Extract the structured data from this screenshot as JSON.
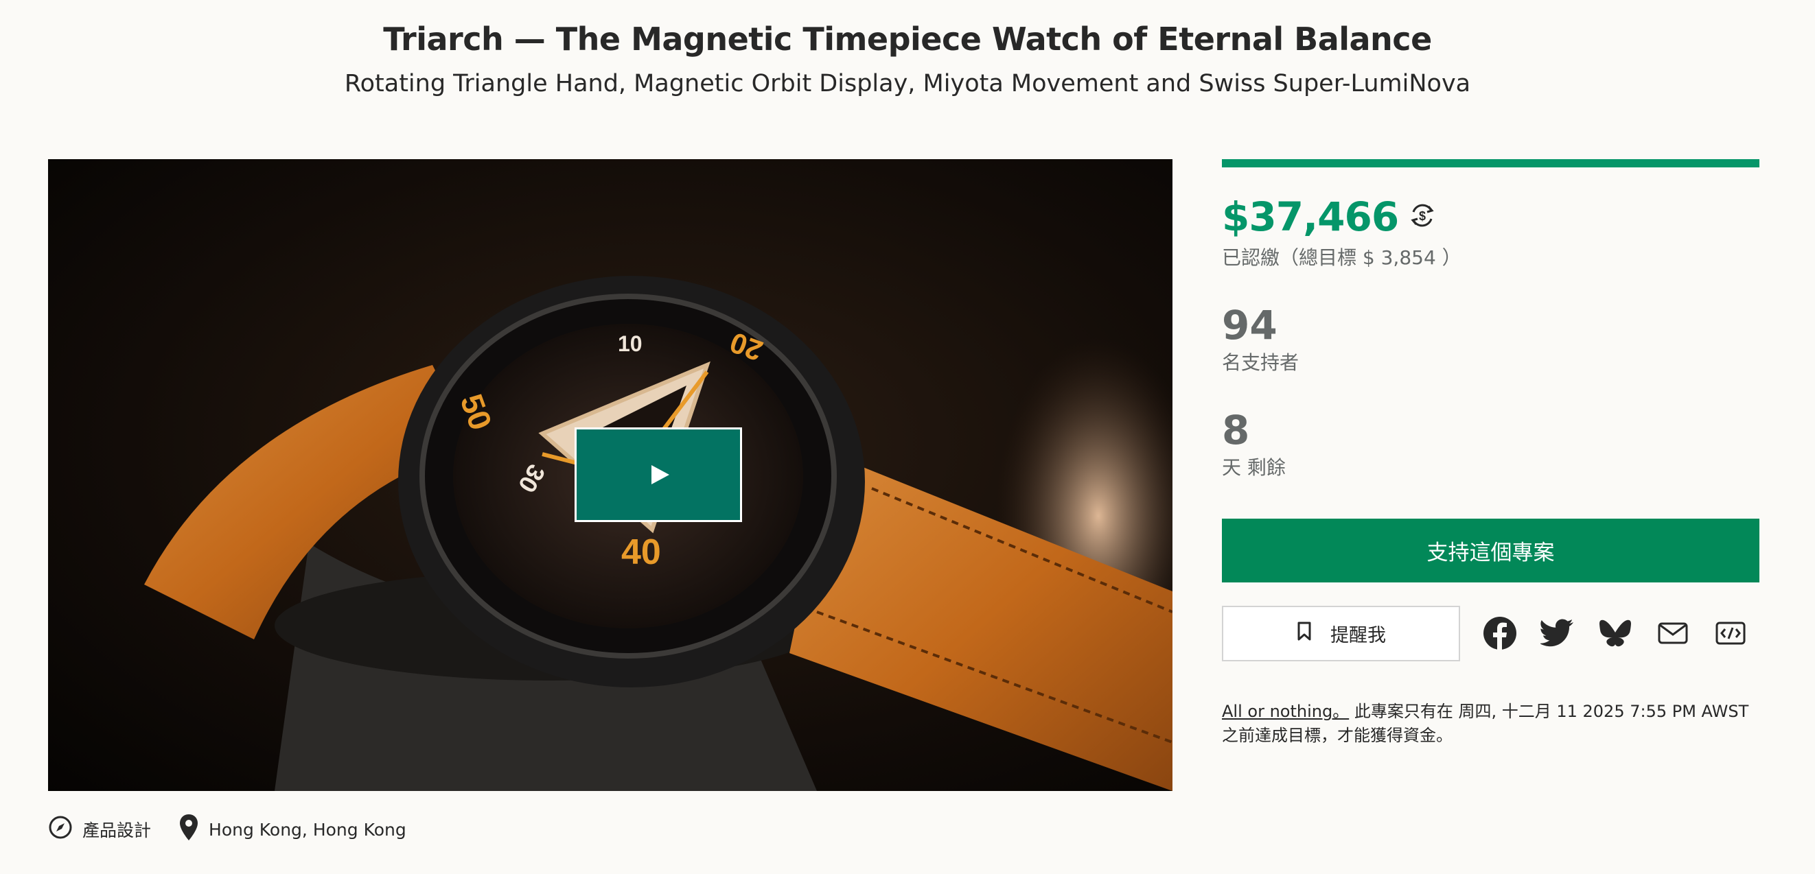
{
  "project": {
    "title": "Triarch — The Magnetic Timepiece Watch of Eternal Balance",
    "subtitle": "Rotating Triangle Hand, Magnetic Orbit Display, Miyota Movement and Swiss Super-LumiNova"
  },
  "media": {
    "play_icon": "play-icon",
    "dial_numbers": [
      "10",
      "20",
      "30",
      "40",
      "50"
    ]
  },
  "meta": {
    "category": "產品設計",
    "category_icon": "compass-icon",
    "location": "Hong Kong, Hong Kong",
    "location_icon": "map-pin-icon"
  },
  "stats": {
    "progress_fraction": 1.0,
    "pledged": "$37,466",
    "currency_icon": "currency-convert-icon",
    "goal": "已認繳（總目標 $ 3,854 ）",
    "backers": "94",
    "backers_label": "名支持者",
    "days": "8",
    "days_label": "天 剩餘"
  },
  "actions": {
    "back_label": "支持這個專案",
    "remind_label": "提醒我",
    "remind_icon": "bookmark-icon",
    "share_icons": [
      "facebook-icon",
      "twitter-icon",
      "bluesky-icon",
      "email-icon",
      "embed-icon"
    ]
  },
  "terms": {
    "link": "All or nothing。",
    "text": " 此專案只有在 周四, 十二月 11 2025 7:55 PM AWST 之前達成目標，才能獲得資金。"
  },
  "colors": {
    "accent": "#059669",
    "button": "#028858",
    "play": "#037362",
    "strap": "#c2681a"
  }
}
